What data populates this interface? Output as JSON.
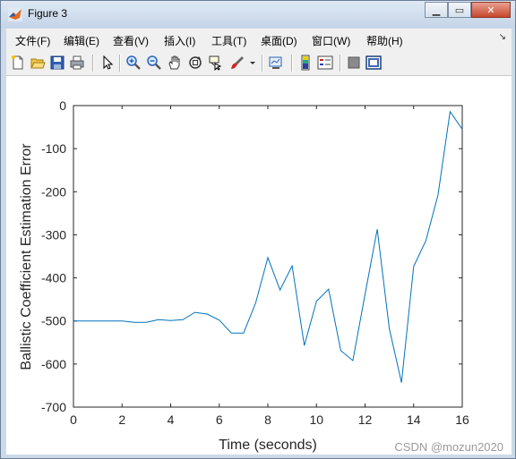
{
  "window": {
    "title": "Figure 3"
  },
  "menu": [
    "文件(F)",
    "编辑(E)",
    "查看(V)",
    "插入(I)",
    "工具(T)",
    "桌面(D)",
    "窗口(W)",
    "帮助(H)"
  ],
  "toolbar_icons": [
    "new-figure-icon",
    "open-file-icon",
    "save-icon",
    "print-icon",
    "edit-plot-icon",
    "zoom-in-icon",
    "zoom-out-icon",
    "pan-icon",
    "rotate-3d-icon",
    "data-cursor-icon",
    "brush-icon",
    "brush-dropdown-icon",
    "link-plot-icon",
    "colorbar-icon",
    "legend-icon",
    "hide-plot-tools-icon",
    "show-plot-tools-icon"
  ],
  "watermark": "CSDN @mozun2020",
  "chart_data": {
    "type": "line",
    "xlabel": "Time (seconds)",
    "ylabel": "Ballistic Coefficient Estimation Error",
    "xlim": [
      0,
      16
    ],
    "ylim": [
      -700,
      0
    ],
    "xticks": [
      "0",
      "2",
      "4",
      "6",
      "8",
      "10",
      "12",
      "14",
      "16"
    ],
    "yticks": [
      "0",
      "-100",
      "-200",
      "-300",
      "-400",
      "-500",
      "-600",
      "-700"
    ],
    "grid": false,
    "color": "#0072bd",
    "x": [
      0,
      0.5,
      1,
      1.5,
      2,
      2.5,
      3,
      3.5,
      4,
      4.5,
      5,
      5.5,
      6,
      6.5,
      7,
      7.5,
      8,
      8.5,
      9,
      9.5,
      10,
      10.5,
      11,
      11.5,
      12,
      12.5,
      13,
      13.5,
      14,
      14.5,
      15,
      15.5,
      16
    ],
    "y": [
      -500,
      -500,
      -500,
      -500,
      -500,
      -503,
      -503,
      -497,
      -499,
      -497,
      -480,
      -484,
      -498,
      -528,
      -528,
      -458,
      -353,
      -428,
      -372,
      -557,
      -454,
      -426,
      -569,
      -592,
      -438,
      -287,
      -518,
      -643,
      -373,
      -314,
      -208,
      -14,
      -55
    ]
  }
}
